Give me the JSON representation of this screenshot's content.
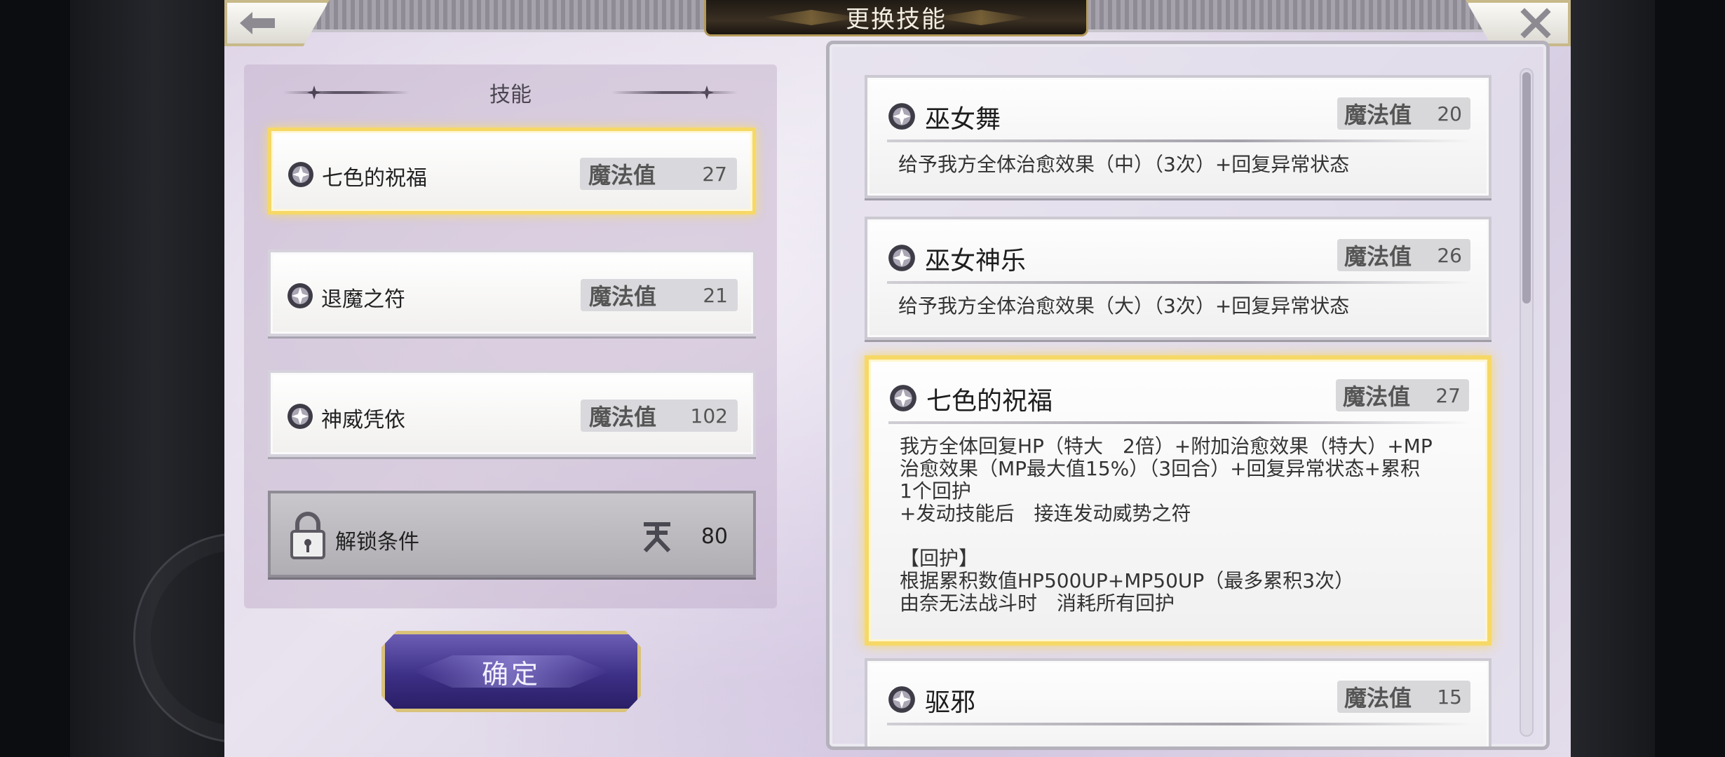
{
  "title": "更换技能",
  "left_panel": {
    "header": "技能",
    "slots": [
      {
        "name": "七色的祝福",
        "mp_label": "魔法值",
        "mp": "27"
      },
      {
        "name": "退魔之符",
        "mp_label": "魔法值",
        "mp": "21"
      },
      {
        "name": "神威凭依",
        "mp_label": "魔法值",
        "mp": "102"
      }
    ],
    "unlock": {
      "label": "解锁条件",
      "value": "80"
    }
  },
  "confirm_label": "确定",
  "skill_list": [
    {
      "name": "巫女舞",
      "mp_label": "魔法值",
      "mp": "20",
      "desc": "给予我方全体治愈效果（中）（3次）+回复异常状态"
    },
    {
      "name": "巫女神乐",
      "mp_label": "魔法值",
      "mp": "26",
      "desc": "给予我方全体治愈效果（大）（3次）+回复异常状态"
    },
    {
      "name": "七色的祝福",
      "mp_label": "魔法值",
      "mp": "27",
      "desc": "我方全体回复HP（特大　2倍）+附加治愈效果（特大）+MP\n治愈效果（MP最大值15%）（3回合）+回复异常状态+累积\n1个回护\n+发动技能后　接连发动威势之符\n\n【回护】\n根据累积数值HP500UP+MP50UP（最多累积3次）\n由奈无法战斗时　消耗所有回护"
    },
    {
      "name": "驱邪",
      "mp_label": "魔法值",
      "mp": "15",
      "desc": ""
    }
  ],
  "icons": {
    "back": "arrow-left-icon",
    "close": "close-icon",
    "skill": "skill-gear-icon",
    "lock": "padlock-icon",
    "tian": "tian-emblem-icon"
  },
  "colors": {
    "highlight": "#f6d867",
    "confirm": "#3c2f86"
  }
}
